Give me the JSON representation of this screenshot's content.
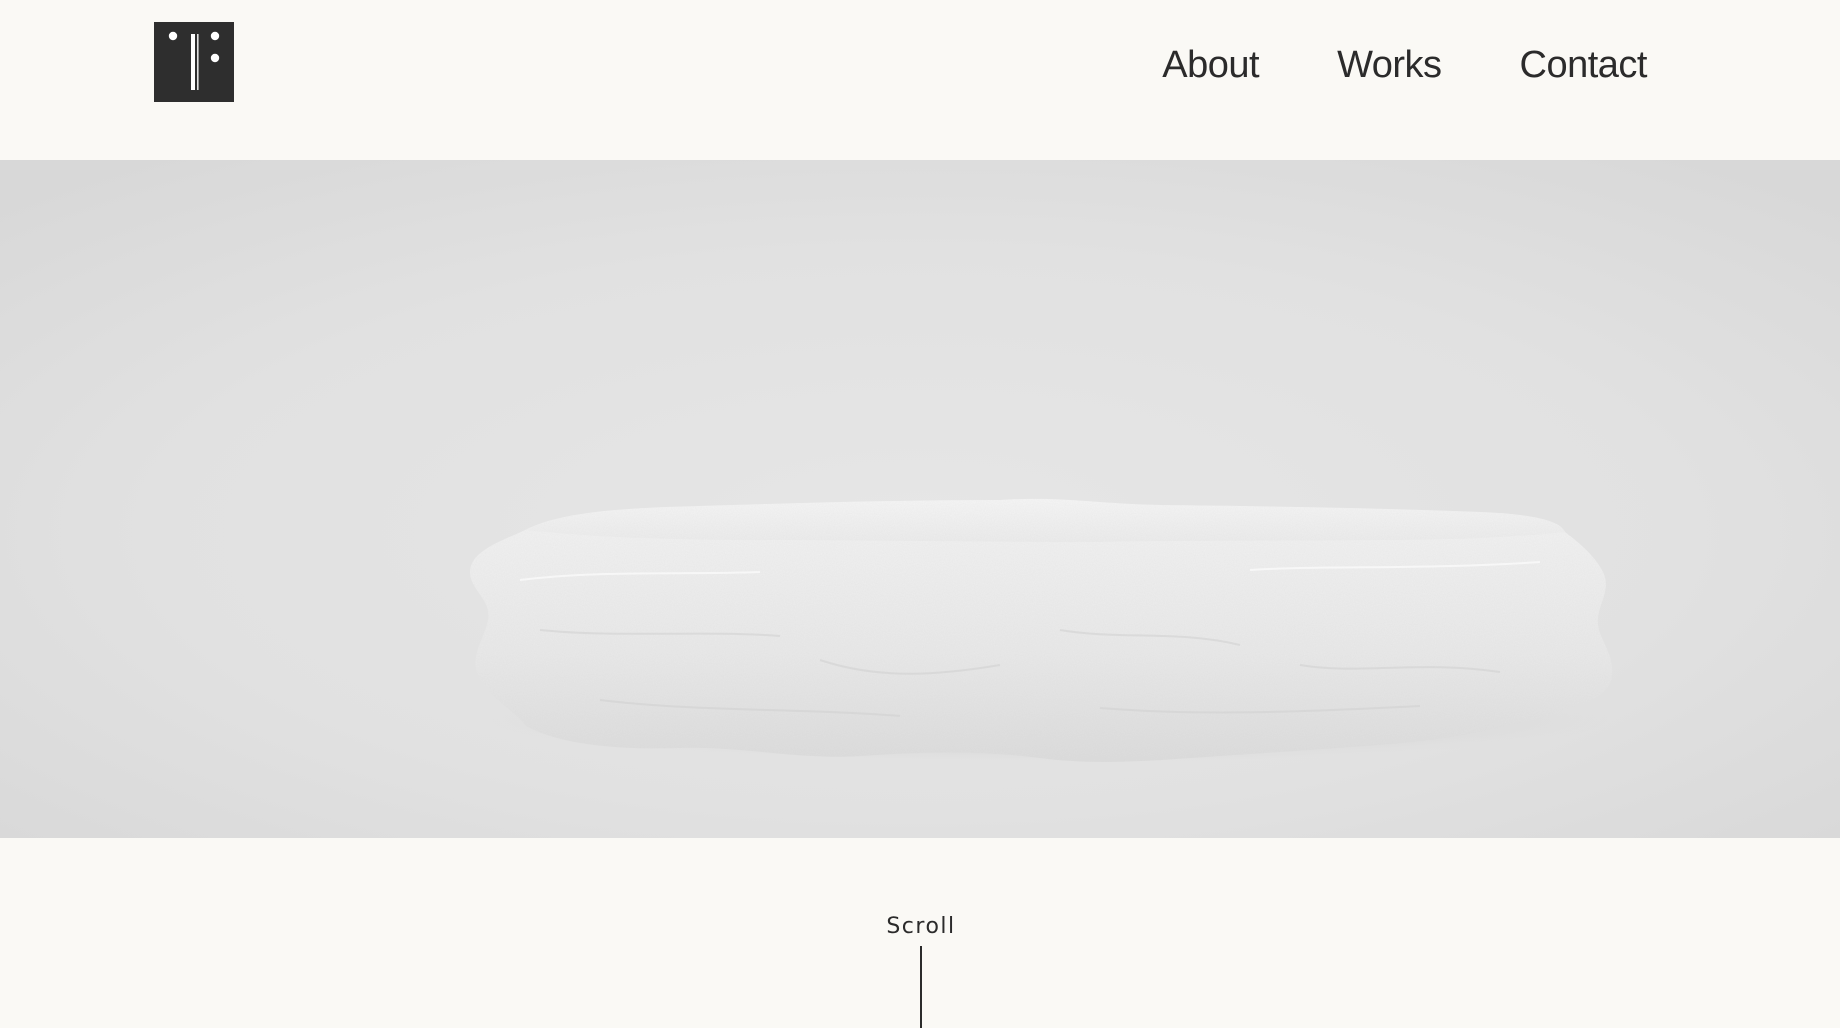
{
  "header": {
    "logo_icon": "brand-logo-icon",
    "logo_color": "#2e2e2e",
    "nav": [
      {
        "label": "About"
      },
      {
        "label": "Works"
      },
      {
        "label": "Contact"
      }
    ]
  },
  "hero": {
    "image_subject": "stone-podium-image",
    "background_color": "#e0e0e0"
  },
  "scroll": {
    "label": "Scroll"
  },
  "colors": {
    "page_background": "#faf9f5",
    "text": "#2b2b2b"
  }
}
